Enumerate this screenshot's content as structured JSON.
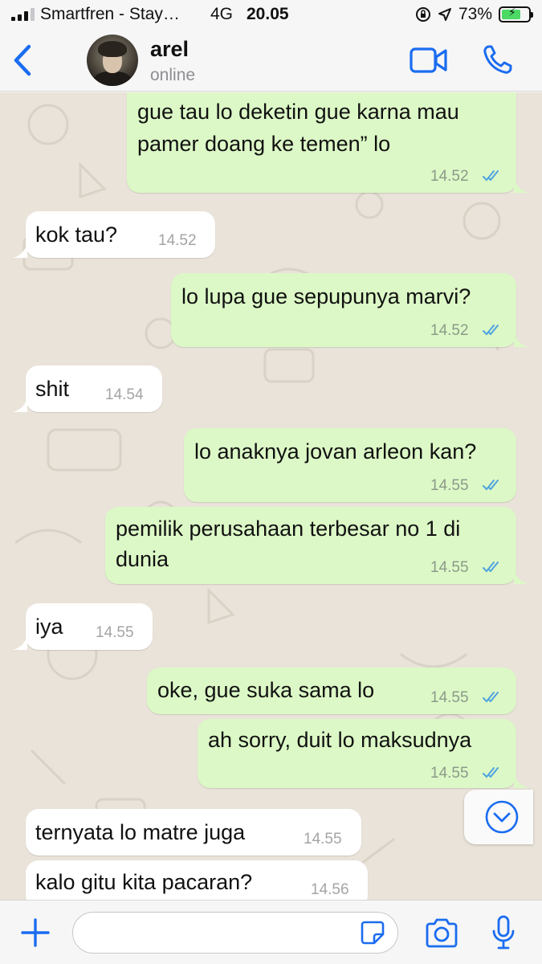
{
  "status_bar": {
    "carrier": "Smartfren - Stay…",
    "network": "4G",
    "time": "20.05",
    "battery": "73%",
    "battery_level": 0.73
  },
  "header": {
    "contact_name": "arel",
    "contact_status": "online",
    "icons": [
      "back-chevron-icon",
      "video-call-icon",
      "phone-icon"
    ]
  },
  "messages": [
    {
      "direction": "out",
      "text_lines": [
        "gue tau lo deketin gue karna mau",
        "pamer doang ke temen” lo"
      ],
      "time": "14.52",
      "read": true
    },
    {
      "direction": "in",
      "text_lines": [
        "kok tau?"
      ],
      "time": "14.52"
    },
    {
      "direction": "out",
      "text_lines": [
        "lo lupa gue sepupunya marvi?"
      ],
      "time": "14.52",
      "read": true
    },
    {
      "direction": "in",
      "text_lines": [
        "shit"
      ],
      "time": "14.54"
    },
    {
      "direction": "out",
      "text_lines": [
        "lo anaknya jovan arleon kan?"
      ],
      "time": "14.55",
      "read": true
    },
    {
      "direction": "out",
      "text_lines": [
        "pemilik perusahaan terbesar no 1 di",
        "dunia"
      ],
      "time": "14.55",
      "read": true
    },
    {
      "direction": "in",
      "text_lines": [
        "iya"
      ],
      "time": "14.55"
    },
    {
      "direction": "out",
      "text_lines": [
        "oke, gue suka sama lo"
      ],
      "time": "14.55",
      "read": true
    },
    {
      "direction": "out",
      "text_lines": [
        "ah sorry, duit lo maksudnya"
      ],
      "time": "14.55",
      "read": true
    },
    {
      "direction": "in",
      "text_lines": [
        "ternyata lo matre juga"
      ],
      "time": "14.55"
    },
    {
      "direction": "in",
      "text_lines": [
        "kalo gitu kita pacaran?"
      ],
      "time": "14.56"
    }
  ],
  "input": {
    "value": "",
    "placeholder": ""
  },
  "colors": {
    "accent": "#1a6cf0",
    "outgoing_bubble": "#dcf8c6",
    "incoming_bubble": "#ffffff",
    "read_ticks": "#4fa3e0",
    "wallpaper": "#e9e3d9"
  }
}
